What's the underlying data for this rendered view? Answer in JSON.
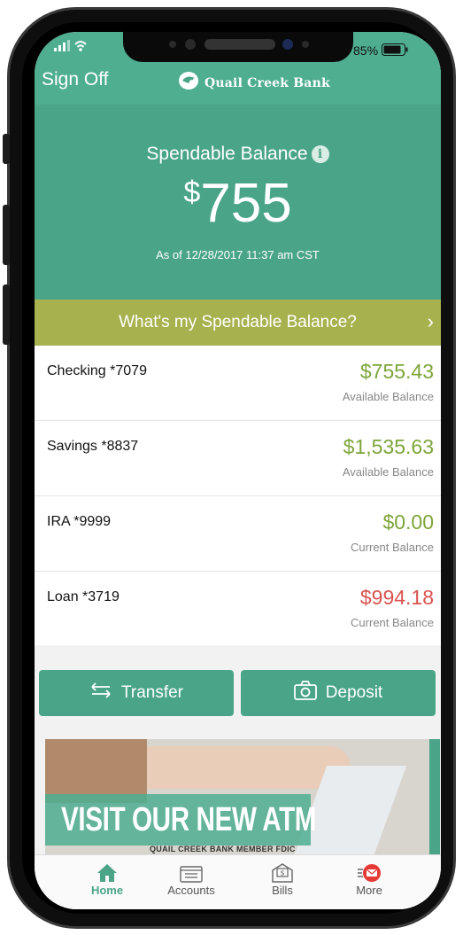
{
  "status_bar": {
    "battery": "85%"
  },
  "header": {
    "sign_off": "Sign Off",
    "bank_name": "Quail Creek Bank",
    "spendable_label": "Spendable Balance",
    "balance_currency": "$",
    "balance_amount": "755",
    "as_of": "As of  12/28/2017 11:37 am CST"
  },
  "whats_my_balance": {
    "label": "What's my Spendable Balance?"
  },
  "accounts": [
    {
      "name": "Checking *7079",
      "value": "$755.43",
      "sublabel": "Available Balance",
      "status": "positive"
    },
    {
      "name": "Savings *8837",
      "value": "$1,535.63",
      "sublabel": "Available Balance",
      "status": "positive"
    },
    {
      "name": "IRA *9999",
      "value": "$0.00",
      "sublabel": "Current Balance",
      "status": "positive"
    },
    {
      "name": "Loan *3719",
      "value": "$994.18",
      "sublabel": "Current Balance",
      "status": "negative"
    }
  ],
  "actions": {
    "transfer": "Transfer",
    "deposit": "Deposit"
  },
  "banner": {
    "headline": "VISIT OUR NEW ATM",
    "fine_print": "QUAIL CREEK BANK  MEMBER FDIC"
  },
  "tabs": [
    {
      "label": "Home",
      "icon": "home-icon",
      "active": true
    },
    {
      "label": "Accounts",
      "icon": "folder-icon",
      "active": false
    },
    {
      "label": "Bills",
      "icon": "bill-icon",
      "active": false
    },
    {
      "label": "More",
      "icon": "mail-icon",
      "active": false
    }
  ],
  "colors": {
    "primary": "#4aa588",
    "accent_bar": "#a7b24e",
    "positive": "#7da53a",
    "negative": "#d9534f",
    "alert": "#e53935"
  }
}
